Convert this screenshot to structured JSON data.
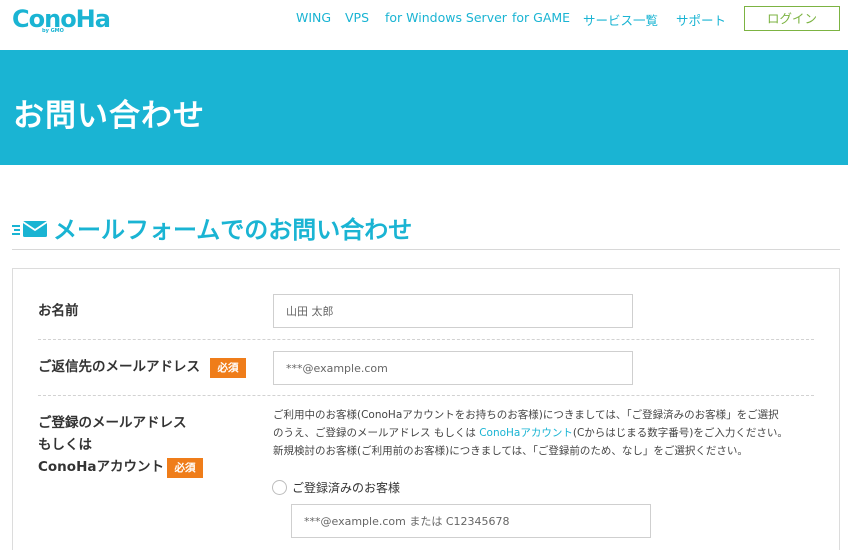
{
  "brand": {
    "name": "ConoHa",
    "sub": "by GMO"
  },
  "nav": {
    "items": [
      "WING",
      "VPS",
      "for Windows Server",
      "for GAME",
      "サービス一覧",
      "サポート"
    ],
    "login": "ログイン"
  },
  "hero": {
    "title": "お問い合わせ"
  },
  "section": {
    "title": "メールフォームでのお問い合わせ",
    "icon": "mail-icon"
  },
  "form": {
    "required_label": "必須",
    "name": {
      "label": "お名前",
      "placeholder": "山田 太郎"
    },
    "reply_email": {
      "label": "ご返信先のメールアドレス",
      "placeholder": "***@example.com"
    },
    "account": {
      "label_line1": "ご登録のメールアドレス",
      "label_line2": "もしくは",
      "label_line3": "ConoHaアカウント",
      "desc_line1": "ご利用中のお客様(ConoHaアカウントをお持ちのお客様)につきましては、「ご登録済みのお客様」をご選択",
      "desc_line2_pre": "のうえ、ご登録のメールアドレス もしくは ",
      "desc_line2_link": "ConoHaアカウント",
      "desc_line2_post": "(Cからはじまる数字番号)をご入力ください。",
      "desc_line3": "新規検討のお客様(ご利用前のお客様)につきましては、「ご登録前のため、なし」をご選択ください。",
      "option_registered": "ご登録済みのお客様",
      "account_placeholder": "***@example.com または C12345678"
    }
  },
  "colors": {
    "brand": "#1ab4d3",
    "required": "#ef7d1a",
    "login_border": "#7cb342"
  }
}
